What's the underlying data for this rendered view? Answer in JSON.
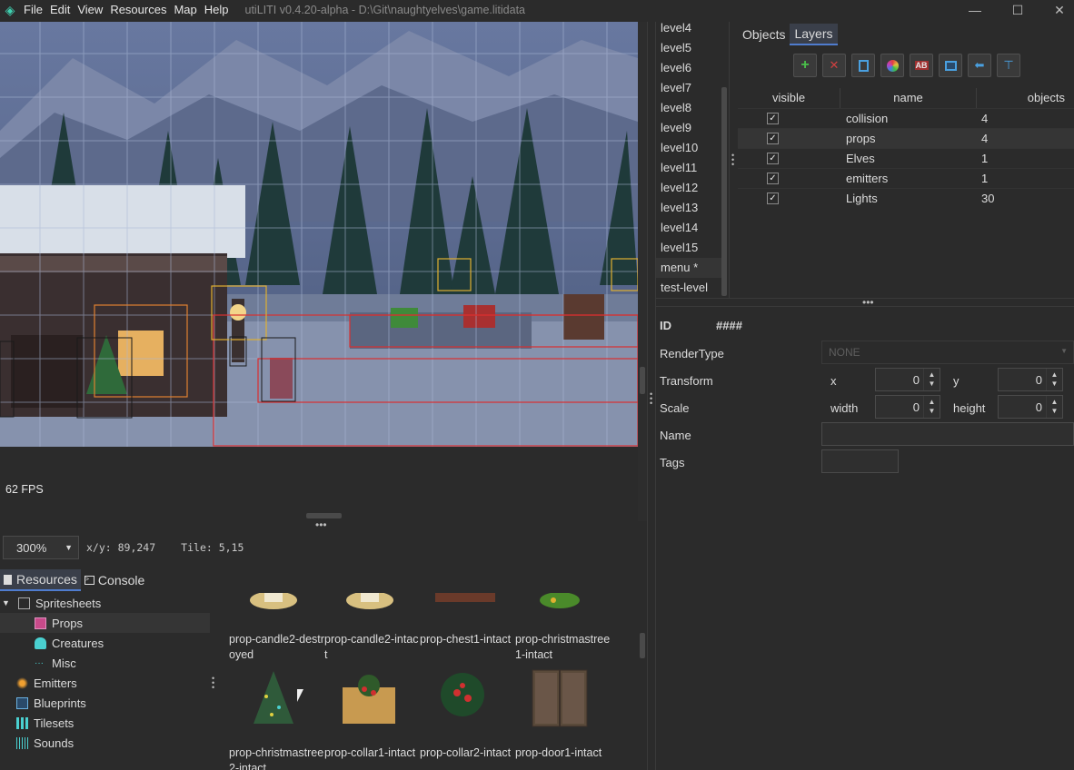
{
  "app": {
    "title": "utiLITI v0.4.20-alpha - D:\\Git\\naughtyelves\\game.litidata",
    "menu": [
      "File",
      "Edit",
      "View",
      "Resources",
      "Map",
      "Help"
    ],
    "window_controls": [
      "minimize-icon",
      "maximize-icon",
      "close-icon"
    ]
  },
  "canvas": {
    "fps": "62 FPS",
    "zoom": "300%",
    "coords": "x/y: 89,247",
    "tile": "Tile: 5,15"
  },
  "bottom_tabs": [
    "Resources",
    "Console"
  ],
  "resource_tree": [
    {
      "label": "Spritesheets",
      "icon": "spritesheet-icon",
      "expanded": true
    },
    {
      "label": "Props",
      "icon": "props-icon",
      "selected": true
    },
    {
      "label": "Creatures",
      "icon": "creatures-icon"
    },
    {
      "label": "Misc",
      "icon": "misc-icon"
    },
    {
      "label": "Emitters",
      "icon": "emitters-icon"
    },
    {
      "label": "Blueprints",
      "icon": "blueprints-icon"
    },
    {
      "label": "Tilesets",
      "icon": "tilesets-icon"
    },
    {
      "label": "Sounds",
      "icon": "sounds-icon"
    }
  ],
  "resources": [
    "prop-candle2-destroyed",
    "prop-candle2-intact",
    "prop-chest1-intact",
    "prop-christmastree1-intact",
    "prop-christmastree2-intact",
    "prop-collar1-intact",
    "prop-collar2-intact",
    "prop-door1-intact"
  ],
  "levels": [
    "level4",
    "level5",
    "level6",
    "level7",
    "level8",
    "level9",
    "level10",
    "level11",
    "level12",
    "level13",
    "level14",
    "level15",
    "menu *",
    "test-level"
  ],
  "right_tabs": [
    "Objects",
    "Layers"
  ],
  "layer_toolbar": [
    "add-icon",
    "delete-icon",
    "duplicate-icon",
    "color-icon",
    "rename-icon",
    "layer-select-icon",
    "move-up-icon",
    "move-top-icon"
  ],
  "layers_table": {
    "headers": [
      "visible",
      "name",
      "objects"
    ],
    "rows": [
      {
        "visible": true,
        "name": "collision",
        "objects": "4"
      },
      {
        "visible": true,
        "name": "props",
        "objects": "4"
      },
      {
        "visible": true,
        "name": "Elves",
        "objects": "1"
      },
      {
        "visible": true,
        "name": "emitters",
        "objects": "1"
      },
      {
        "visible": true,
        "name": "Lights",
        "objects": "30"
      }
    ]
  },
  "properties": {
    "id_label": "ID",
    "id_value": "####",
    "rendertype_label": "RenderType",
    "rendertype_value": "NONE",
    "transform_label": "Transform",
    "x_label": "x",
    "x_value": "0",
    "y_label": "y",
    "y_value": "0",
    "scale_label": "Scale",
    "width_label": "width",
    "width_value": "0",
    "height_label": "height",
    "height_value": "0",
    "name_label": "Name",
    "tags_label": "Tags"
  },
  "colors": {
    "accent": "#4f7ccf",
    "grid": "#9fb0d0",
    "collision_box": "#d93030",
    "selection_box": "#e0b030"
  }
}
